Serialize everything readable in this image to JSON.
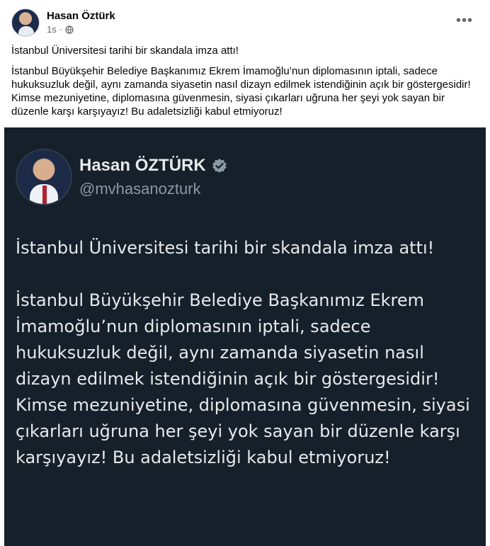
{
  "post": {
    "author": "Hasan Öztürk",
    "time": "1s",
    "more_label": "•••",
    "line1": "İstanbul Üniversitesi tarihi bir skandala imza attı!",
    "line2": "İstanbul Büyükşehir Belediye Başkanımız Ekrem İmamoğlu’nun diplomasının iptali, sadece hukuksuzluk değil, aynı zamanda siyasetin nasıl dizayn edilmek istendiğinin açık bir göstergesidir! Kimse mezuniyetine, diplomasına güvenmesin, siyasi çıkarları uğruna her şeyi yok sayan bir düzenle karşı karşıyayız! Bu adaletsizliği kabul etmiyoruz!"
  },
  "tweet": {
    "name": "Hasan ÖZTÜRK",
    "handle": "@mvhasanozturk",
    "para1": "İstanbul Üniversitesi tarihi bir skandala imza attı!",
    "para2": "İstanbul Büyükşehir Belediye Başkanımız Ekrem İmamoğlu’nun diplomasının iptali, sadece hukuksuzluk değil, aynı zamanda siyasetin nasıl dizayn edilmek istendiğinin açık bir göstergesidir! Kimse mezuniyetine, diplomasına güvenmesin, siyasi çıkarları uğruna her şeyi yok sayan bir düzenle karşı karşıyayız! Bu adaletsizliği kabul etmiyoruz!"
  },
  "colors": {
    "card_background": "#15202b",
    "card_text": "#e7e9ea",
    "handle_text": "#8b98a5",
    "verified_badge": "#8b98a5"
  },
  "icons": {
    "privacy": "globe-icon",
    "verified": "verified-badge-icon",
    "more": "more-options-icon"
  }
}
